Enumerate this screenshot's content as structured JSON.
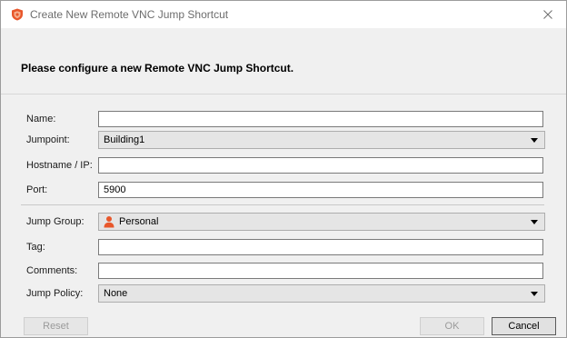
{
  "window": {
    "title": "Create New Remote VNC Jump Shortcut",
    "close_glyph": "✕",
    "app_icon": "shield-icon"
  },
  "header": {
    "instruction": "Please configure a new Remote VNC Jump Shortcut."
  },
  "form": {
    "name": {
      "label": "Name:",
      "value": ""
    },
    "jumpoint": {
      "label": "Jumpoint:",
      "value": "Building1"
    },
    "hostname": {
      "label": "Hostname / IP:",
      "value": ""
    },
    "port": {
      "label": "Port:",
      "value": "5900"
    },
    "jump_group": {
      "label": "Jump Group:",
      "value": "Personal",
      "icon": "person-icon"
    },
    "tag": {
      "label": "Tag:",
      "value": ""
    },
    "comments": {
      "label": "Comments:",
      "value": ""
    },
    "jump_policy": {
      "label": "Jump Policy:",
      "value": "None"
    }
  },
  "buttons": {
    "reset": "Reset",
    "ok": "OK",
    "cancel": "Cancel"
  },
  "colors": {
    "brand_shield": "#e8572b",
    "person_icon": "#e8572b",
    "background": "#f0f0f0"
  }
}
